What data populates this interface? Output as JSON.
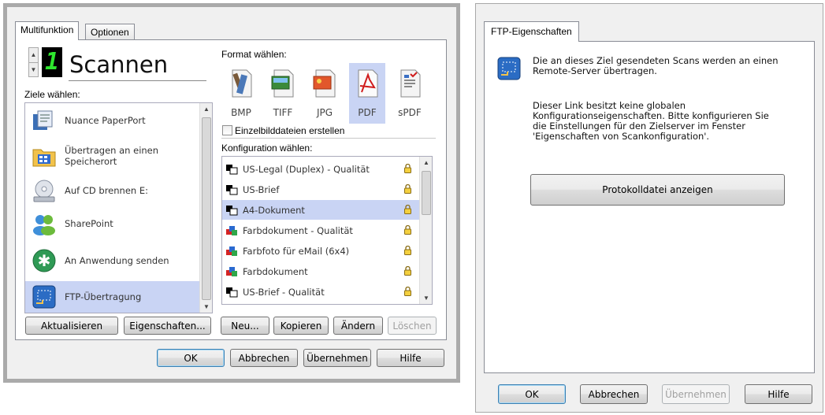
{
  "left_window": {
    "tabs": [
      "Multifunktion",
      "Optionen"
    ],
    "lcd_digit": "1",
    "title": "Scannen",
    "destinations_label": "Ziele wählen:",
    "destinations": [
      {
        "label": "Nuance PaperPort",
        "icon": "paperport-icon"
      },
      {
        "label": "Übertragen an einen\nSpeicherort",
        "icon": "folder-icon"
      },
      {
        "label": "Auf CD brennen  E:",
        "icon": "cd-drive-icon"
      },
      {
        "label": "SharePoint",
        "icon": "sharepoint-icon"
      },
      {
        "label": "An Anwendung senden",
        "icon": "send-to-app-icon"
      },
      {
        "label": "FTP-Übertragung",
        "icon": "ftp-icon",
        "selected": true
      }
    ],
    "format_label": "Format wählen:",
    "formats": [
      {
        "label": "BMP",
        "icon": "bmp-icon"
      },
      {
        "label": "TIFF",
        "icon": "tiff-icon"
      },
      {
        "label": "JPG",
        "icon": "jpg-icon"
      },
      {
        "label": "PDF",
        "icon": "pdf-icon",
        "selected": true
      },
      {
        "label": "sPDF",
        "icon": "spdf-icon"
      }
    ],
    "single_images_label": "Einzelbilddateien erstellen",
    "single_images_checked": false,
    "config_label": "Konfiguration wählen:",
    "configurations": [
      {
        "label": "US-Legal (Duplex) - Qualität",
        "icon": "bw-document-icon"
      },
      {
        "label": "US-Brief",
        "icon": "bw-document-icon"
      },
      {
        "label": "A4-Dokument",
        "icon": "bw-document-icon",
        "selected": true
      },
      {
        "label": "Farbdokument - Qualität",
        "icon": "color-document-icon"
      },
      {
        "label": "Farbfoto für eMail (6x4)",
        "icon": "color-document-icon"
      },
      {
        "label": "Farbdokument",
        "icon": "color-document-icon"
      },
      {
        "label": "US-Brief - Qualität",
        "icon": "bw-document-icon"
      }
    ],
    "buttons": {
      "refresh": "Aktualisieren",
      "properties": "Eigenschaften...",
      "new": "Neu...",
      "copy": "Kopieren",
      "edit": "Ändern",
      "delete": "Löschen",
      "ok": "OK",
      "cancel": "Abbrechen",
      "apply": "Übernehmen",
      "help": "Hilfe"
    }
  },
  "right_window": {
    "tab": "FTP-Eigenschaften",
    "info_text": "Die an dieses Ziel gesendeten Scans werden an einen\nRemote-Server übertragen.",
    "note_text": "Dieser Link besitzt keine globalen\nKonfigurationseigenschaften. Bitte konfigurieren Sie\ndie Einstellungen für den Zielserver im Fenster\n'Eigenschaften von Scankonfiguration'.",
    "log_button": "Protokolldatei anzeigen",
    "buttons": {
      "ok": "OK",
      "cancel": "Abbrechen",
      "apply": "Übernehmen",
      "help": "Hilfe"
    }
  },
  "colors": {
    "selection": "#c9d4f4",
    "lcd_digit": "#2ee62e",
    "window_bg": "#f0f0f0"
  }
}
